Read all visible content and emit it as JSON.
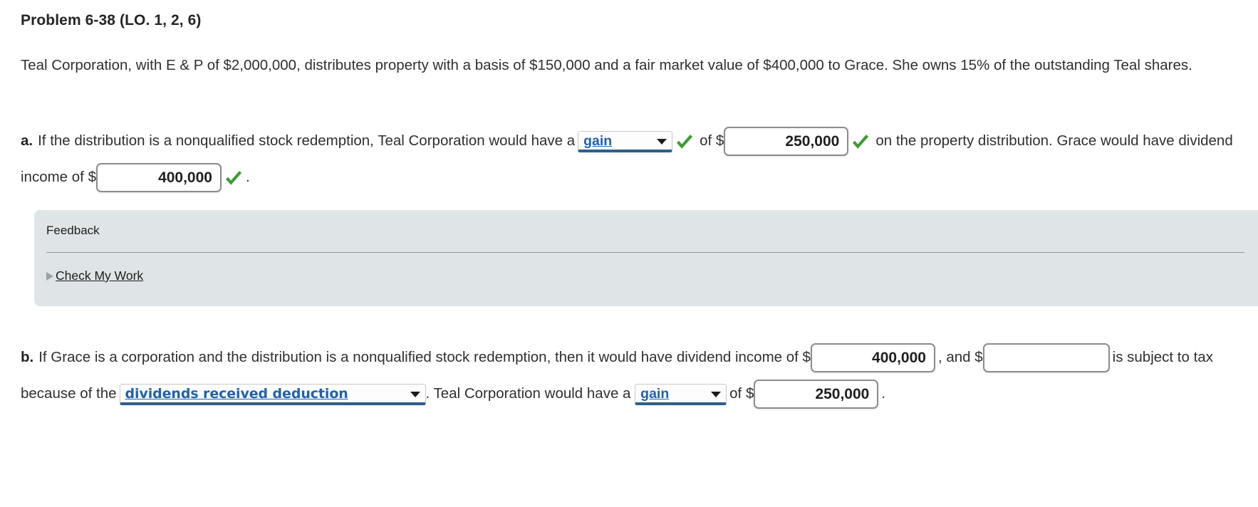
{
  "problem": {
    "title": "Problem 6-38 (LO. 1, 2, 6)",
    "intro": "Teal Corporation, with E & P of $2,000,000, distributes property with a basis of $150,000 and a fair market value of $400,000 to Grace. She owns 15% of the outstanding Teal shares."
  },
  "part_a": {
    "label": "a.",
    "text_1": "If the distribution is a nonqualified stock redemption, Teal Corporation would have a",
    "select_gain": "gain",
    "text_2": "of $",
    "input_250000": "250,000",
    "text_3": "on the property distribution. Grace would have dividend income of $",
    "input_400000": "400,000",
    "text_4": "."
  },
  "feedback": {
    "title": "Feedback",
    "check_my_work": "Check My Work"
  },
  "part_b": {
    "label": "b.",
    "text_1": "If Grace is a corporation and the distribution is a nonqualified stock redemption, then it would have dividend income of",
    "dollar_1": "$",
    "input_400000": "400,000",
    "text_2": ", and $",
    "input_empty": "",
    "text_3": "is subject to tax because of the",
    "select_drd": "dividends received deduction",
    "text_4": ". Teal Corporation would have a",
    "select_gain": "gain",
    "text_5": "of $",
    "input_250000": "250,000",
    "text_6": "."
  },
  "icons": {
    "correct_check": "green-check-icon",
    "dropdown_arrow": "chevron-down-icon",
    "expand_triangle": "triangle-right-icon"
  },
  "colors": {
    "select_text": "#2162ab",
    "select_underline": "#2d5f8b",
    "check_green": "#3f9b35",
    "feedback_bg": "#dfe5e7",
    "body_text": "#2f2f2f"
  }
}
